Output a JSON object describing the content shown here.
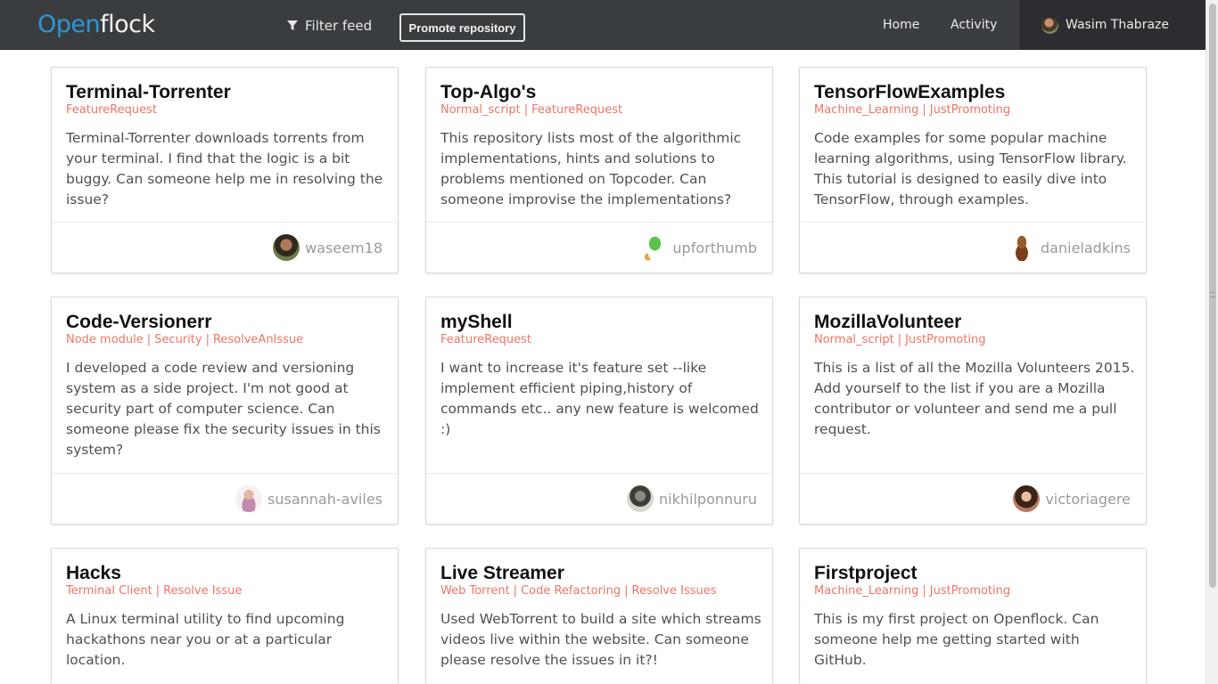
{
  "header": {
    "logo_part1": "Open",
    "logo_part2": "flock",
    "filter_label": "Filter feed",
    "promote_label": "Promote repository",
    "nav": {
      "home": "Home",
      "activity": "Activity"
    },
    "user_name": "Wasim Thabraze"
  },
  "cards": [
    {
      "title": "Terminal-Torrenter",
      "tags": [
        "FeatureRequest"
      ],
      "description": "Terminal-Torrenter downloads torrents from your terminal. I find that the logic is a bit buggy. Can someone help me in resolving the issue?",
      "user": "waseem18"
    },
    {
      "title": "Top-Algo's",
      "tags": [
        "Normal_script",
        "FeatureRequest"
      ],
      "description": "This repository lists most of the algorithmic implementations, hints and solutions to problems mentioned on Topcoder. Can someone improvise the implementations?",
      "user": "upforthumb"
    },
    {
      "title": "TensorFlowExamples",
      "tags": [
        "Machine_Learning",
        "JustPromoting"
      ],
      "description": "Code examples for some popular machine learning algorithms, using TensorFlow library. This tutorial is designed to easily dive into TensorFlow, through examples.",
      "user": "danieladkins"
    },
    {
      "title": "Code-Versionerr",
      "tags": [
        "Node module",
        "Security",
        "ResolveAnIssue"
      ],
      "description": "I developed a code review and versioning system as a side project. I'm not good at security part of computer science. Can someone please fix the security issues in this system?",
      "user": "susannah-aviles"
    },
    {
      "title": "myShell",
      "tags": [
        "FeatureRequest"
      ],
      "description": "I want to increase it's feature set --like implement efficient piping,history of commands etc.. any new feature is welcomed :)",
      "user": "nikhilponnuru"
    },
    {
      "title": "MozillaVolunteer",
      "tags": [
        "Normal_script",
        "JustPromoting"
      ],
      "description": "This is a list of all the Mozilla Volunteers 2015. Add yourself to the list if you are a Mozilla contributor or volunteer and send me a pull request.",
      "user": "victoriagere"
    },
    {
      "title": "Hacks",
      "tags": [
        "Terminal Client",
        "Resolve Issue"
      ],
      "description": "A Linux terminal utility to find upcoming hackathons near you or at a particular location."
    },
    {
      "title": "Live Streamer",
      "tags": [
        "Web Torrent",
        "Code Refactoring",
        "Resolve Issues"
      ],
      "description": "Used WebTorrent to build a site which streams videos live within the website. Can someone please resolve the issues in it?!"
    },
    {
      "title": "Firstproject",
      "tags": [
        "Machine_Learning",
        "JustPromoting"
      ],
      "description": "This is my first project on Openflock. Can someone help me getting started with GitHub."
    }
  ]
}
